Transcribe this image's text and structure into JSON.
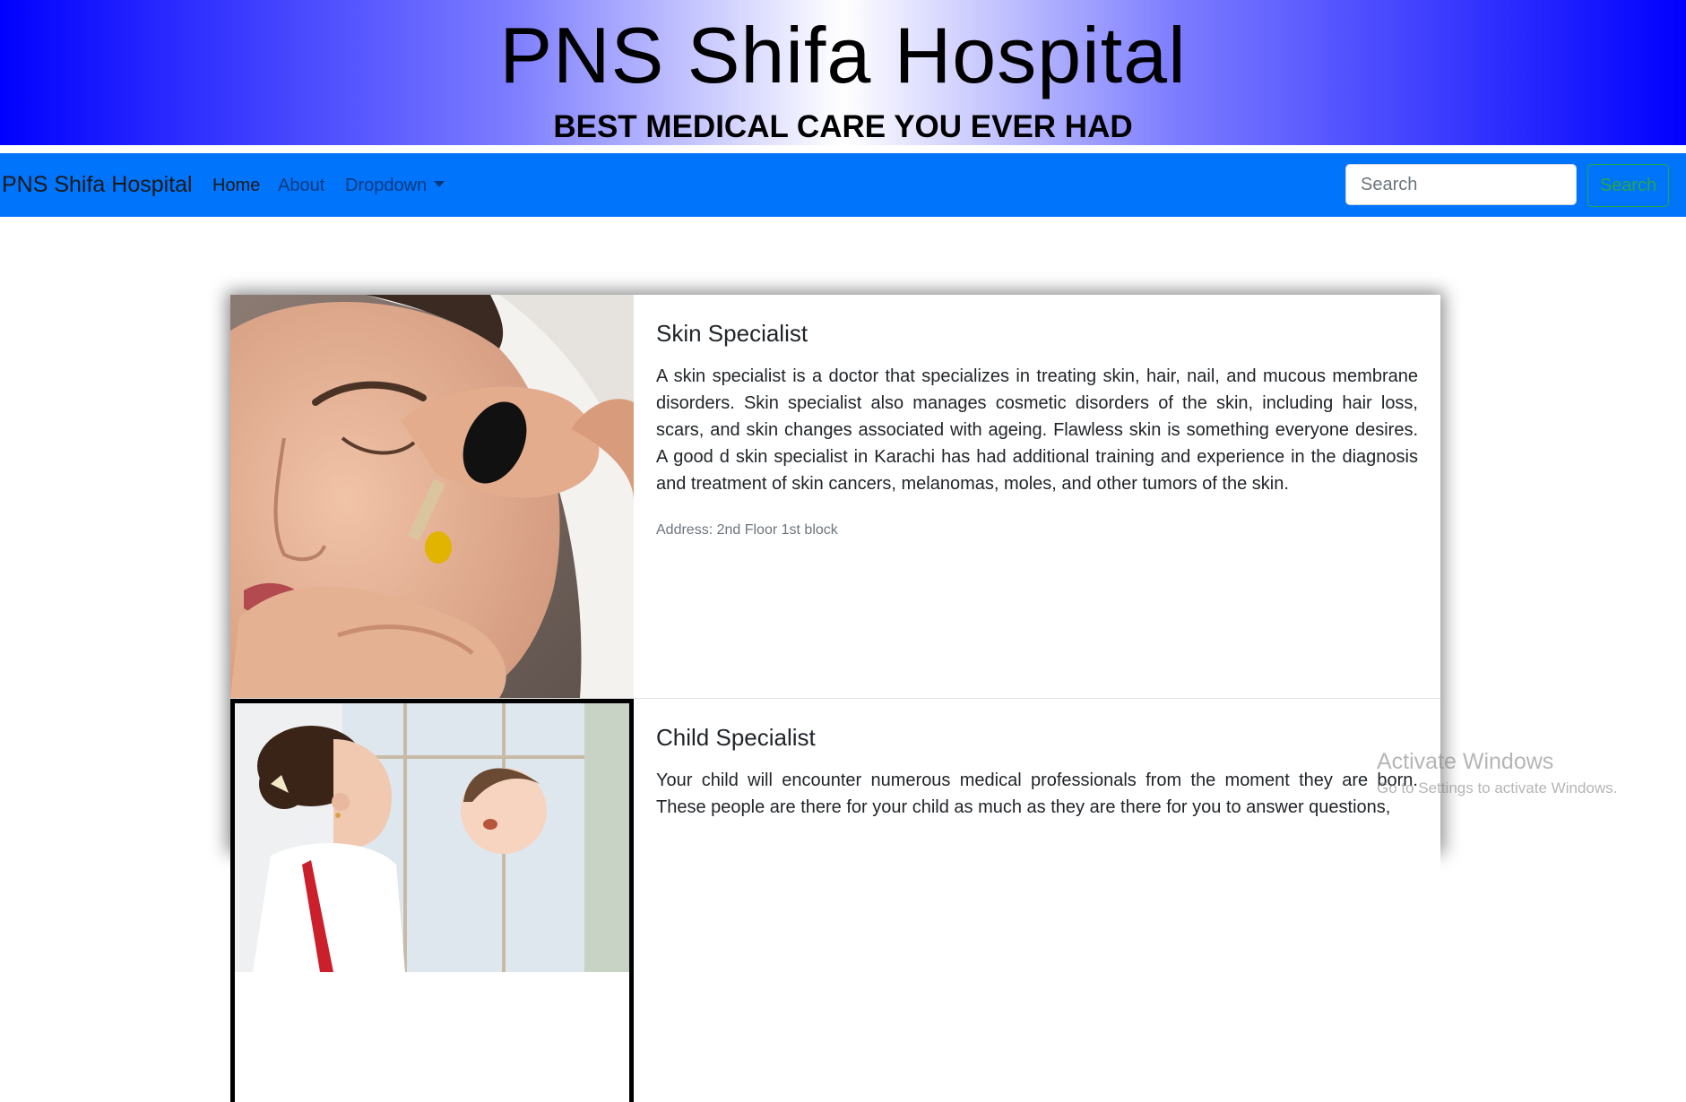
{
  "header": {
    "title": "PNS Shifa Hospital",
    "subtitle": "BEST MEDICAL CARE YOU EVER HAD"
  },
  "navbar": {
    "brand": "PNS Shifa Hospital",
    "items": [
      {
        "label": "Home"
      },
      {
        "label": "About"
      },
      {
        "label": "Dropdown"
      }
    ],
    "search": {
      "placeholder": "Search",
      "value": ""
    },
    "search_button": "Search"
  },
  "cards": [
    {
      "title": "Skin Specialist",
      "text": "A skin specialist is a doctor that specializes in treating skin, hair, nail, and mucous membrane disorders. Skin specialist also manages cosmetic disorders of the skin, including hair loss, scars, and skin changes associated with ageing. Flawless skin is something everyone desires. A good d skin specialist in Karachi has had additional training and experience in the diagnosis and treatment of skin cancers, melanomas, moles, and other tumors of the skin.",
      "address": "Address: 2nd Floor 1st block"
    },
    {
      "title": "Child Specialist",
      "text": "Your child will encounter numerous medical professionals from the moment they are born. These people are there for your child as much as they are there for you to answer questions,"
    }
  ],
  "watermark": {
    "title": "Activate Windows",
    "subtitle": "Go to Settings to activate Windows."
  }
}
